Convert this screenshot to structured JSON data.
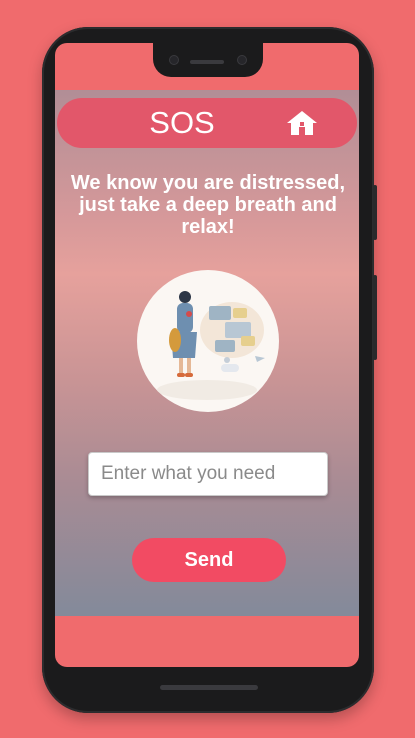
{
  "header": {
    "title": "SOS",
    "home_icon": "home-icon"
  },
  "main": {
    "message": "We know you are distressed, just take a deep breath and relax!",
    "illustration": "person-with-chat-bubbles-illustration",
    "need_input": {
      "value": "",
      "placeholder": "Enter what you need"
    },
    "send_label": "Send"
  },
  "colors": {
    "background": "#f06b6d",
    "topbar": "#e2576a",
    "send_button": "#f24b63",
    "text": "#ffffff"
  }
}
